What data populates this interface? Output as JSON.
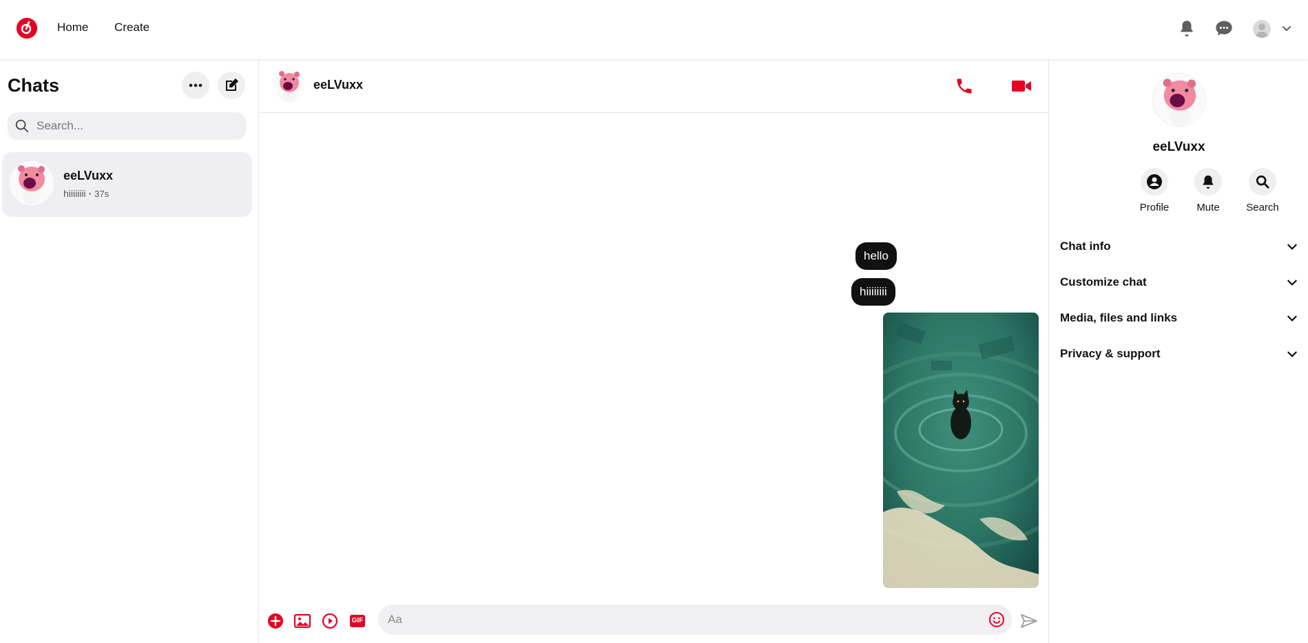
{
  "colors": {
    "brand": "#e60023",
    "bubble": "#111111",
    "panel_bg": "#efeff3"
  },
  "nav": {
    "home_label": "Home",
    "create_label": "Create"
  },
  "sidebar": {
    "title": "Chats",
    "search_placeholder": "Search...",
    "chats": [
      {
        "name": "eeLVuxx",
        "preview": "hiiiiiiii",
        "time": "37s"
      }
    ]
  },
  "conversation": {
    "name": "eeLVuxx",
    "messages": [
      {
        "text": "hello",
        "from": "me"
      },
      {
        "text": "hiiiiiiii",
        "from": "me"
      },
      {
        "type": "image",
        "description_icon": "cat-in-water-image",
        "from": "me"
      }
    ],
    "composer_placeholder": "Aa",
    "gif_label": "GIF"
  },
  "details": {
    "name": "eeLVuxx",
    "actions": [
      {
        "label": "Profile",
        "icon": "profile-icon"
      },
      {
        "label": "Mute",
        "icon": "bell-icon"
      },
      {
        "label": "Search",
        "icon": "search-icon"
      }
    ],
    "sections": [
      {
        "label": "Chat info"
      },
      {
        "label": "Customize chat"
      },
      {
        "label": "Media, files and links"
      },
      {
        "label": "Privacy & support"
      }
    ]
  }
}
